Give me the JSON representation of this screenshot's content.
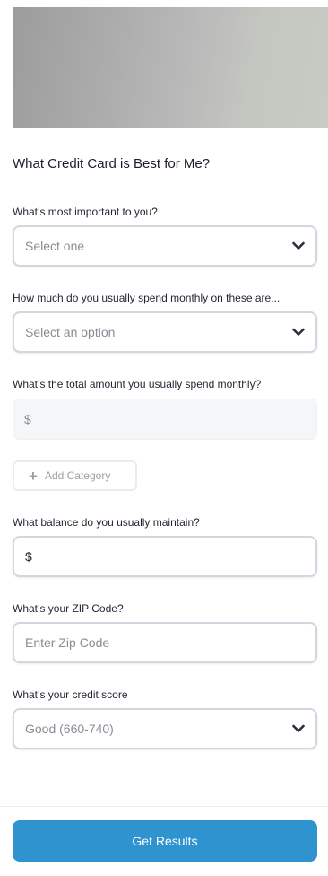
{
  "form": {
    "title": "What Credit Card is Best for Me?",
    "fields": [
      {
        "label": "What’s most important to you?",
        "placeholder": "Select one"
      },
      {
        "label": "How much do you usually spend monthly on these are...",
        "placeholder": "Select an option"
      },
      {
        "label": "What’s the total amount you usually spend monthly?",
        "placeholder": "$"
      },
      {
        "label": "What balance do you usually maintain?",
        "value": "$"
      },
      {
        "label": "What’s your ZIP Code?",
        "placeholder": "Enter Zip Code"
      },
      {
        "label": "What’s your credit score",
        "value": "Good (660-740)"
      }
    ],
    "add_category_label": "Add Category",
    "submit_label": "Get Results"
  },
  "icons": {
    "dropdown": "chevron-down-icon",
    "add": "plus-icon"
  },
  "colors": {
    "primary_button": "#2f93cf",
    "field_border": "#d3d6de"
  }
}
